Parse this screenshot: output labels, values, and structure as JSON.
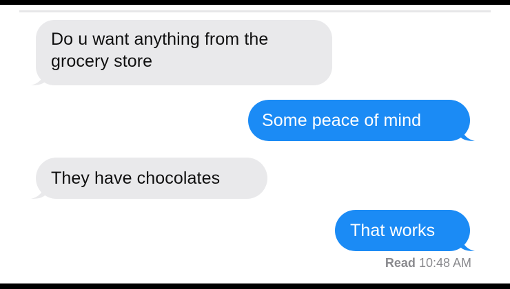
{
  "conversation": {
    "messages": [
      {
        "direction": "incoming",
        "text": "Do u want anything from the grocery store"
      },
      {
        "direction": "outgoing",
        "text": "Some peace of mind"
      },
      {
        "direction": "incoming",
        "text": "They have chocolates"
      },
      {
        "direction": "outgoing",
        "text": "That works"
      }
    ],
    "read_receipt": {
      "label": "Read",
      "time": "10:48 AM"
    }
  },
  "colors": {
    "incoming_bubble": "#e9e9eb",
    "outgoing_bubble": "#1b8bf5",
    "incoming_text": "#101010",
    "outgoing_text": "#ffffff",
    "receipt_text": "#8a8a8e"
  }
}
